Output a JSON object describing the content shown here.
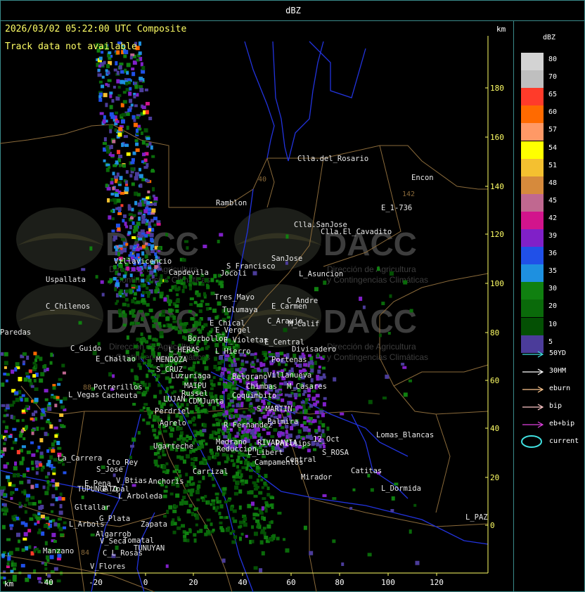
{
  "top_title": "dBZ",
  "header": {
    "timestamp": "2026/03/02 05:22:00 UTC Composite",
    "track_status": "Track data not available",
    "km_label": "km"
  },
  "axes": {
    "x_unit": "km",
    "x_ticks": [
      "-40",
      "-20",
      "0",
      "20",
      "40",
      "60",
      "80",
      "100",
      "120"
    ],
    "y_ticks": [
      "180",
      "160",
      "140",
      "120",
      "100",
      "80",
      "60",
      "40",
      "20",
      "0"
    ]
  },
  "watermark": {
    "brand": "DACC",
    "line1": "Dirección de Agricultura",
    "line2": "y Contingencias Climáticas"
  },
  "route_labels": [
    "40",
    "142",
    "88",
    "84"
  ],
  "places": [
    "Clla.del_Rosario",
    "Encon",
    "E_1-736",
    "Ramblon",
    "Clla.SanJose",
    "Clla.El_Cavadito",
    "Villavicencio",
    "Capdevila",
    "S_Francisco",
    "SanJose",
    "Uspallata",
    "Jocoli",
    "L_Asuncion",
    "C_Chilenos",
    "Tres_Mayo",
    "C_Andre",
    "Tulumaya",
    "E_Carmen",
    "E_Chical",
    "C_Araujo",
    "M_Calif",
    "E_Vergel",
    "Paredas",
    "Borbollon",
    "E_Violetas",
    "E_Central",
    "Divisadero",
    "C_Guido",
    "L_HERAS",
    "L_Hierro",
    "Portenas",
    "E_Challao",
    "MENDOZA",
    "Belgrano",
    "Villanueva",
    "S_CRUZ",
    "Chimbas",
    "M_Casares",
    "Luzuriaga",
    "MAIPU",
    "Potrerillos",
    "Russel",
    "Coquimbito",
    "L_Vegas",
    "Cacheuta",
    "LUJAN",
    "CDMJunta",
    "Perdriel",
    "S_MARTIN",
    "Agrelo",
    "R_Fernandez",
    "Palmira",
    "Ugarteche",
    "Medrano",
    "Reduccion",
    "RIVADAVIA",
    "Phillips",
    "12_Oct",
    "L_Libert",
    "Campamentos",
    "Central",
    "S_ROSA",
    "Lomas_Blancas",
    "La_Carrera",
    "Cto_Rey",
    "S_Jose",
    "Catitas",
    "Carrizal",
    "V_Btias",
    "E_Pena",
    "Anchoris",
    "TUPUNGATO",
    "L_Arboleda",
    "E_Zpal",
    "Mirador",
    "L_Dormida",
    "Gltallar",
    "G_Plata",
    "L_PAZ",
    "L_Arbols",
    "Zapata",
    "Algarrob",
    "V_Seca",
    "Tomatal",
    "TUNUYAN",
    "Manzano",
    "C_L_Rosas",
    "V_Flores"
  ],
  "legend": {
    "title": "dBZ",
    "levels": [
      {
        "label": "80",
        "color": "#d3d3d3"
      },
      {
        "label": "70",
        "color": "#bfbfbf"
      },
      {
        "label": "65",
        "color": "#ff3b2a"
      },
      {
        "label": "60",
        "color": "#ff6a00"
      },
      {
        "label": "57",
        "color": "#ff9966"
      },
      {
        "label": "54",
        "color": "#ffff00"
      },
      {
        "label": "51",
        "color": "#f4c030"
      },
      {
        "label": "48",
        "color": "#d68a3c"
      },
      {
        "label": "45",
        "color": "#c06890"
      },
      {
        "label": "42",
        "color": "#d2148c"
      },
      {
        "label": "39",
        "color": "#8020c8"
      },
      {
        "label": "36",
        "color": "#2050e8"
      },
      {
        "label": "35",
        "color": "#1e90e0"
      },
      {
        "label": "30",
        "color": "#108010"
      },
      {
        "label": "20",
        "color": "#0a6a0a"
      },
      {
        "label": "10",
        "color": "#045004"
      },
      {
        "label": "5",
        "color": "#4b3c9a"
      }
    ]
  },
  "track_legend": [
    {
      "label": "50YD",
      "color": "#40e0e0"
    },
    {
      "label": "30HM",
      "color": "#ffffff"
    },
    {
      "label": "eburn",
      "color": "#ffc890"
    },
    {
      "label": "bip",
      "color": "#ffc8c8"
    },
    {
      "label": "eb+bip",
      "color": "#e040e0"
    },
    {
      "label": "current",
      "color": "#40e0e0"
    }
  ]
}
